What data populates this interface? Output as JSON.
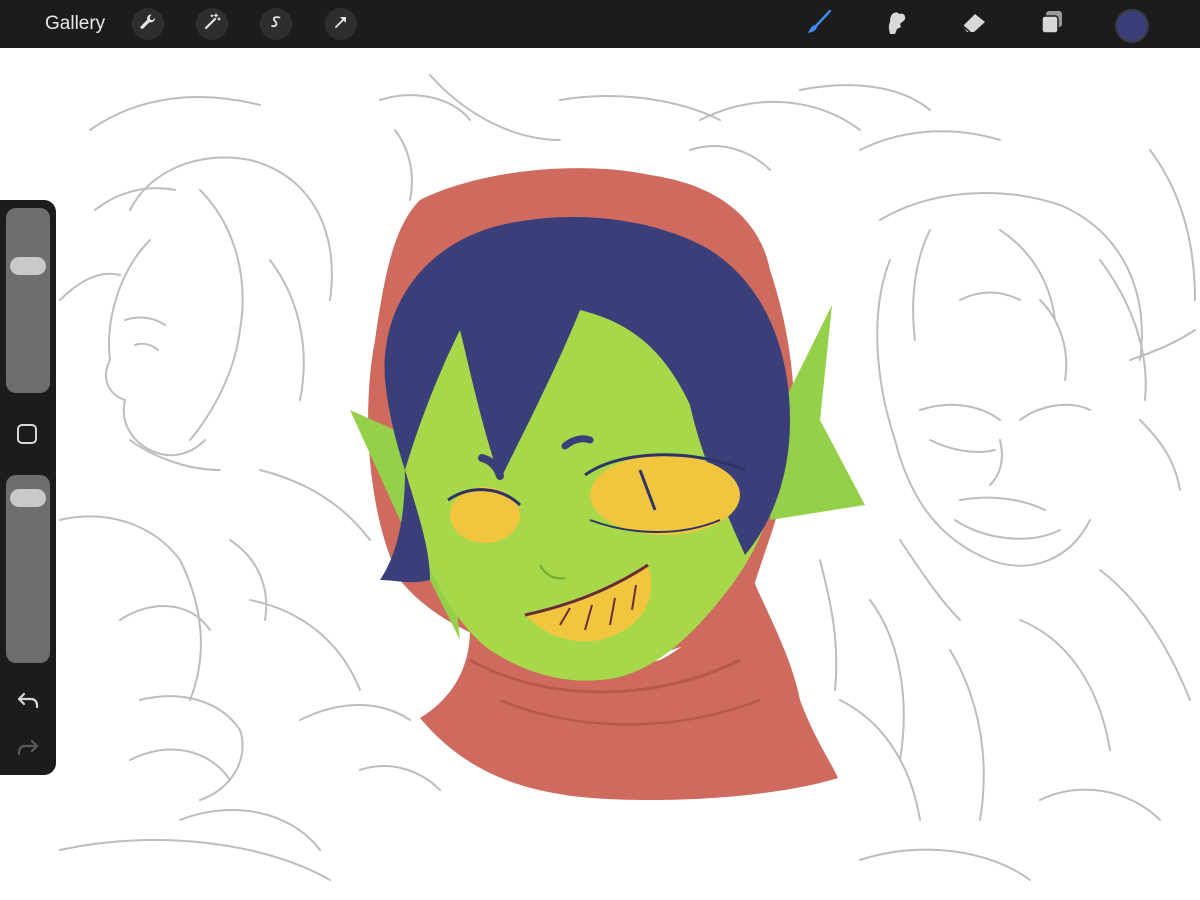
{
  "toolbar": {
    "gallery_label": "Gallery",
    "left_tools": [
      "wrench-icon",
      "magic-wand-icon",
      "selection-s-icon",
      "transform-arrow-icon"
    ],
    "right_tools": [
      "brush-icon",
      "smudge-icon",
      "eraser-icon",
      "layers-icon"
    ],
    "active_tool": "brush-icon",
    "active_tool_color": "#3d8ef0",
    "current_color": "#3a3f7a"
  },
  "sidebar": {
    "brush_size_level": 0.72,
    "opacity_level": 0.94,
    "modify_button": "square-icon",
    "undo_icon": "undo-arrow-icon",
    "redo_icon": "redo-arrow-icon"
  },
  "artwork": {
    "skin_color": "#a7d84a",
    "hood_color": "#cf6a5e",
    "hair_color": "#3a3f7a",
    "eye_color": "#f2c53f",
    "sketch_color": "#bdbdbd"
  }
}
